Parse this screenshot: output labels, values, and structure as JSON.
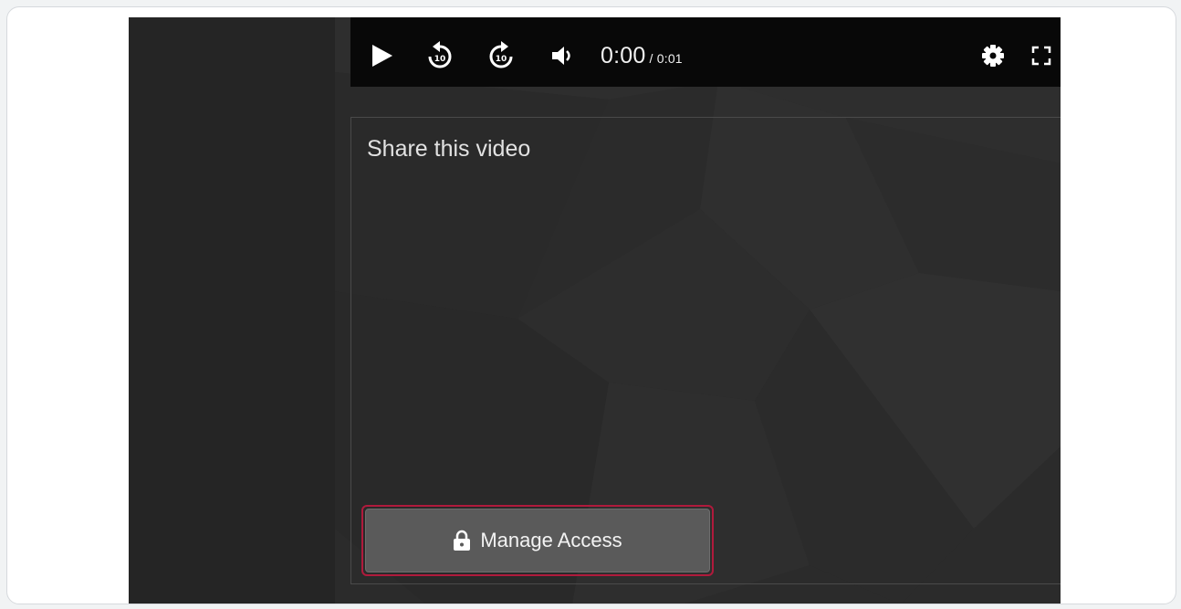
{
  "player": {
    "time_current": "0:00",
    "time_separator": " / ",
    "time_duration": "0:01",
    "icons": [
      "play-icon",
      "rewind-10-icon",
      "forward-10-icon",
      "volume-icon",
      "settings-icon",
      "fullscreen-icon"
    ]
  },
  "share": {
    "title": "Share this video",
    "manage_access_label": "Manage Access"
  },
  "colors": {
    "page_bg": "#f1f3f4",
    "app_bg": "#2b2b2b",
    "sidebar_bg": "#252525",
    "player_bar": "#080808",
    "button_bg": "#5a5a5a",
    "highlight": "#b01a3c"
  }
}
